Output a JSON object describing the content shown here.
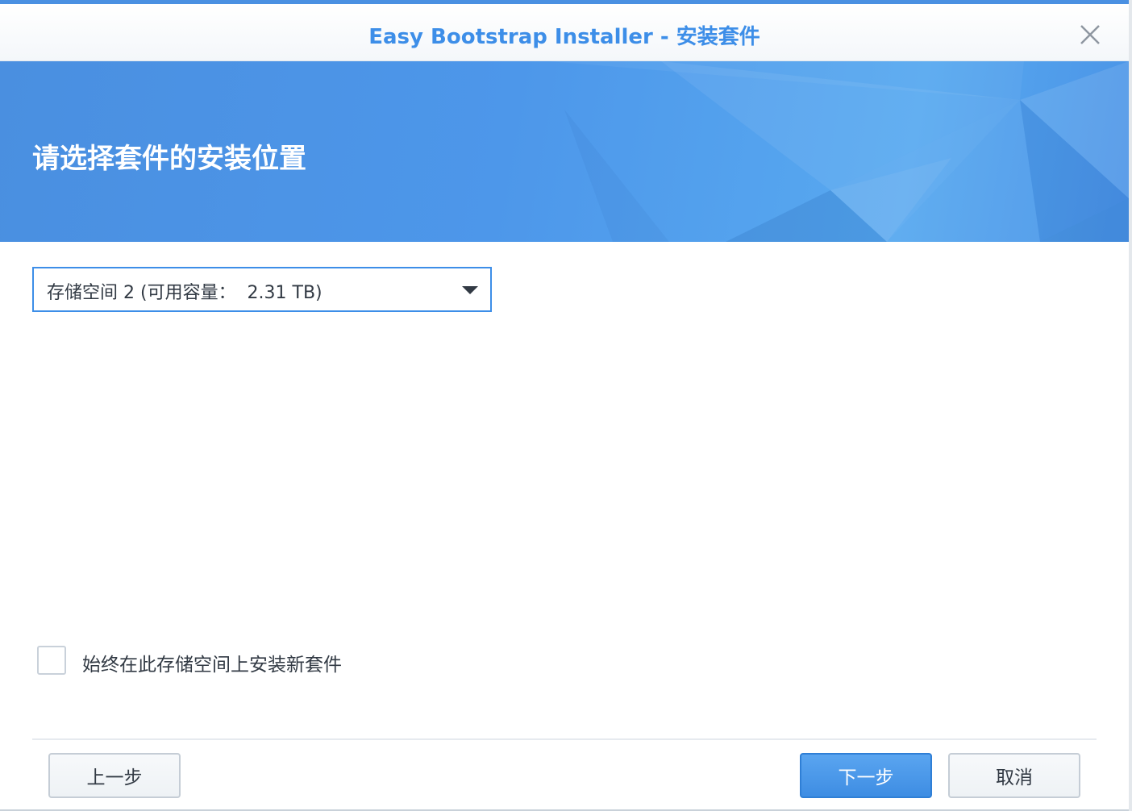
{
  "window": {
    "title": "Easy Bootstrap Installer - 安装套件",
    "close_icon": "close-icon"
  },
  "banner": {
    "heading": "请选择套件的安装位置"
  },
  "volume_select": {
    "selected": "存储空间 2 (可用容量：  2.31 TB)"
  },
  "options": {
    "always_install_label": "始终在此存储空间上安装新套件",
    "always_install_checked": false
  },
  "footer": {
    "back_label": "上一步",
    "next_label": "下一步",
    "cancel_label": "取消"
  },
  "colors": {
    "accent": "#3d8ee8",
    "banner": "#4a93e6",
    "primary_button": "#4a97e8"
  }
}
